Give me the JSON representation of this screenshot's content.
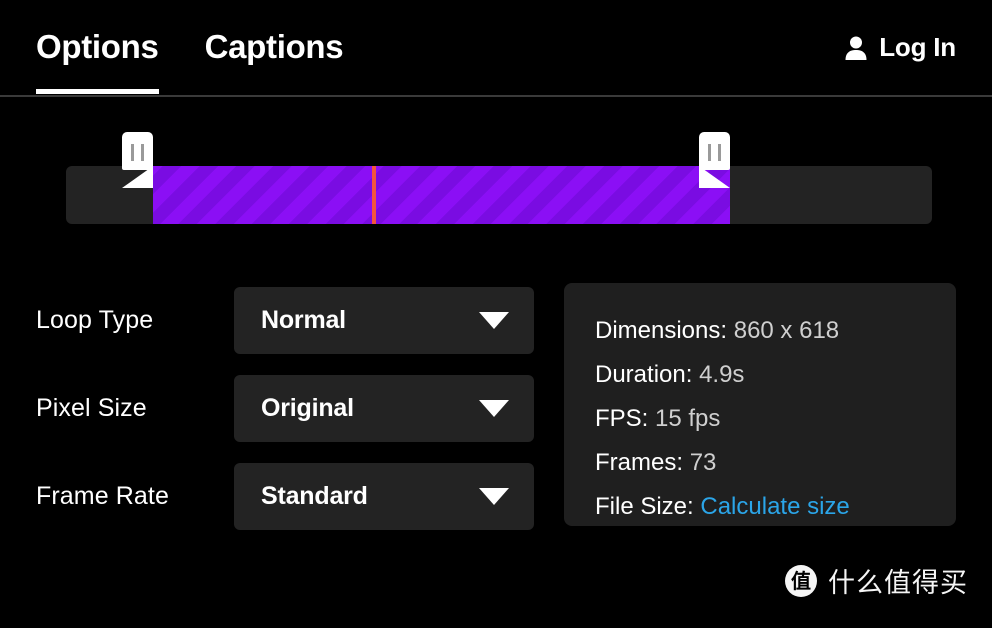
{
  "header": {
    "tabs": [
      {
        "label": "Options",
        "active": true
      },
      {
        "label": "Captions",
        "active": false
      }
    ],
    "login": {
      "label": "Log In",
      "icon": "user-icon"
    },
    "accent_underline_color": "#ffffff",
    "divider_color": "#3a3a3a"
  },
  "timeline": {
    "track_color": "#232323",
    "selection_color": "#8b0ff5",
    "selection_stripe_color": "#7a0ce2",
    "playhead_color": "#f4553e",
    "handle_color": "#ffffff",
    "left_handle_name": "trim-start-handle",
    "right_handle_name": "trim-end-handle"
  },
  "options": [
    {
      "label": "Loop Type",
      "value": "Normal",
      "name": "loop-type"
    },
    {
      "label": "Pixel Size",
      "value": "Original",
      "name": "pixel-size"
    },
    {
      "label": "Frame Rate",
      "value": "Standard",
      "name": "frame-rate"
    }
  ],
  "info": {
    "dimensions": {
      "key": "Dimensions:",
      "value": "860 x 618"
    },
    "duration": {
      "key": "Duration:",
      "value": "4.9s"
    },
    "fps": {
      "key": "FPS:",
      "value": "15 fps"
    },
    "frames": {
      "key": "Frames:",
      "value": "73"
    },
    "file_size": {
      "key": "File Size:",
      "value": "Calculate size",
      "link_color": "#2ba5e8"
    }
  },
  "watermark": {
    "badge": "值",
    "text": "什么值得买"
  }
}
